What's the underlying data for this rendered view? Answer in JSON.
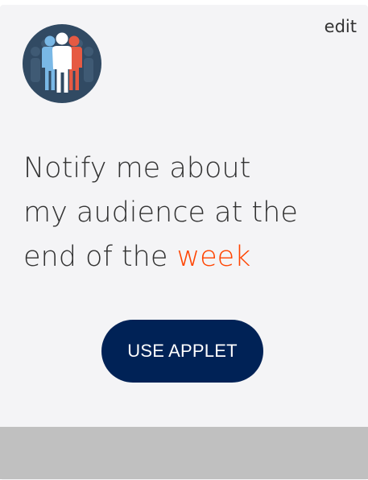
{
  "applet": {
    "icon": "audience-people-icon",
    "edit_label": "edit",
    "title_line1": "Notify me about",
    "title_line2": "my audience at the",
    "title_line3_prefix": "end of the ",
    "title_line3_accent": "week",
    "cta_label": "USE APPLET"
  },
  "colors": {
    "card_bg": "#f4f4f6",
    "avatar_bg": "#314a63",
    "accent": "#ff4400",
    "button_bg": "#002256",
    "footer_band": "#c0c0c0"
  }
}
